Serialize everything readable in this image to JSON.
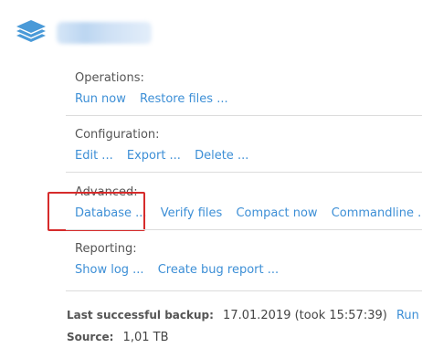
{
  "header": {
    "icon": "stack-layers-icon",
    "accent_color": "#4a9ad8"
  },
  "operations": {
    "title": "Operations:",
    "links": [
      "Run now",
      "Restore files ..."
    ]
  },
  "configuration": {
    "title": "Configuration:",
    "links": [
      "Edit ...",
      "Export ...",
      "Delete ..."
    ]
  },
  "advanced": {
    "title": "Advanced:",
    "links": [
      "Database ...",
      "Verify files",
      "Compact now",
      "Commandline ..."
    ]
  },
  "reporting": {
    "title": "Reporting:",
    "links": [
      "Show log ...",
      "Create bug report ..."
    ]
  },
  "info": {
    "last_backup_label": "Last successful backup:",
    "last_backup_value": "17.01.2019 (took 15:57:39)",
    "run_now_link": "Run no",
    "source_label": "Source:",
    "source_value": "1,01 TB"
  },
  "colors": {
    "link": "#3d8fd6",
    "highlight": "#d62b2b",
    "divider": "#dcdcdc"
  }
}
